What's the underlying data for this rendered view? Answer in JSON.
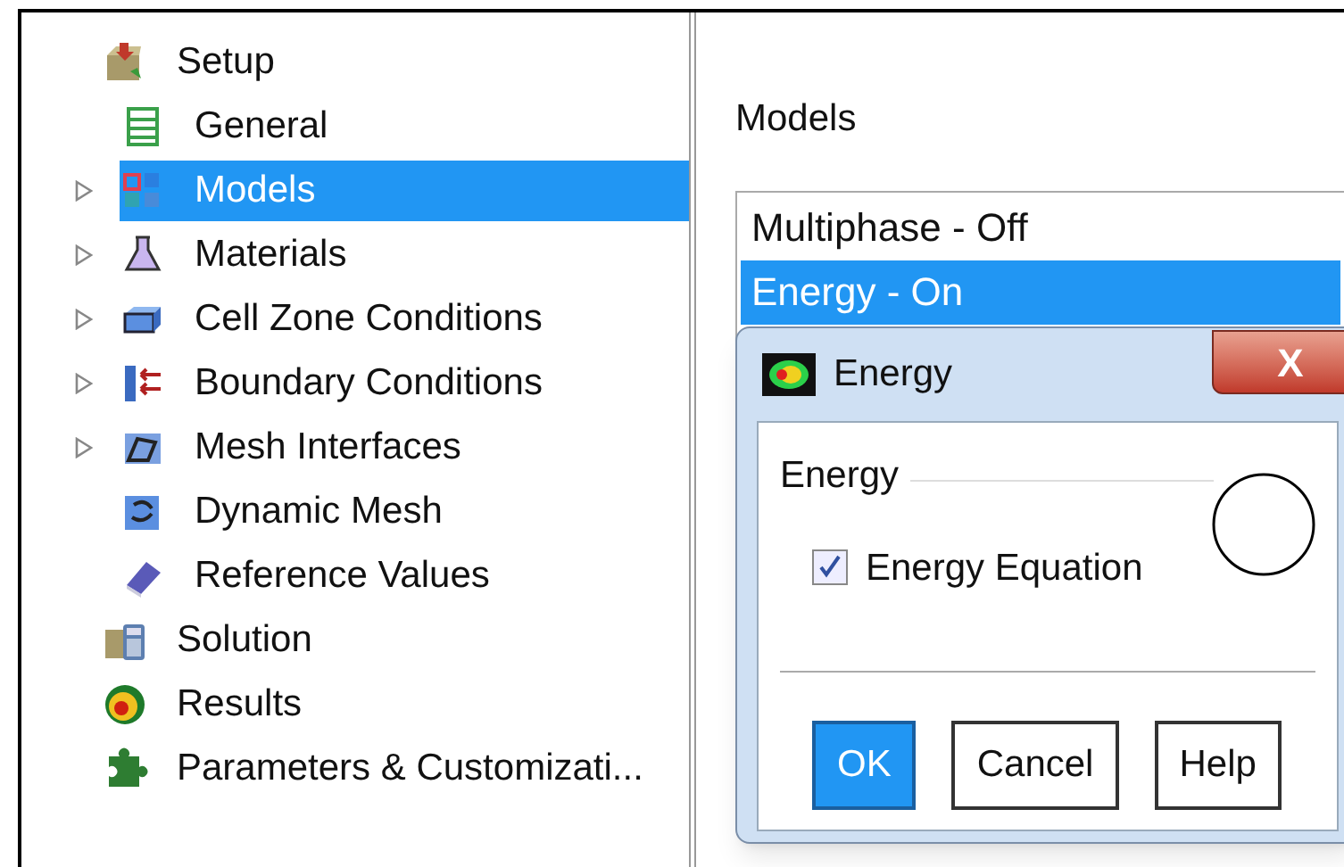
{
  "tree": [
    {
      "label": "Setup",
      "expandable": false,
      "selected": false,
      "children": [
        {
          "label": "General",
          "expandable": false,
          "selected": false
        },
        {
          "label": "Models",
          "expandable": true,
          "selected": true
        },
        {
          "label": "Materials",
          "expandable": true,
          "selected": false
        },
        {
          "label": "Cell Zone Conditions",
          "expandable": true,
          "selected": false
        },
        {
          "label": "Boundary Conditions",
          "expandable": true,
          "selected": false
        },
        {
          "label": "Mesh Interfaces",
          "expandable": true,
          "selected": false
        },
        {
          "label": "Dynamic Mesh",
          "expandable": false,
          "selected": false
        },
        {
          "label": "Reference Values",
          "expandable": false,
          "selected": false
        }
      ]
    },
    {
      "label": "Solution",
      "expandable": false,
      "selected": false
    },
    {
      "label": "Results",
      "expandable": false,
      "selected": false
    },
    {
      "label": "Parameters & Customizati...",
      "expandable": false,
      "selected": false
    }
  ],
  "panel": {
    "title": "Models",
    "models": [
      {
        "label": "Multiphase - Off",
        "selected": false
      },
      {
        "label": "Energy - On",
        "selected": true
      }
    ]
  },
  "dialog": {
    "title": "Energy",
    "close": "X",
    "group": "Energy",
    "checkbox": {
      "label": "Energy Equation",
      "checked": true
    },
    "buttons": [
      {
        "label": "OK",
        "default": true
      },
      {
        "label": "Cancel",
        "default": false
      },
      {
        "label": "Help",
        "default": false
      }
    ]
  }
}
